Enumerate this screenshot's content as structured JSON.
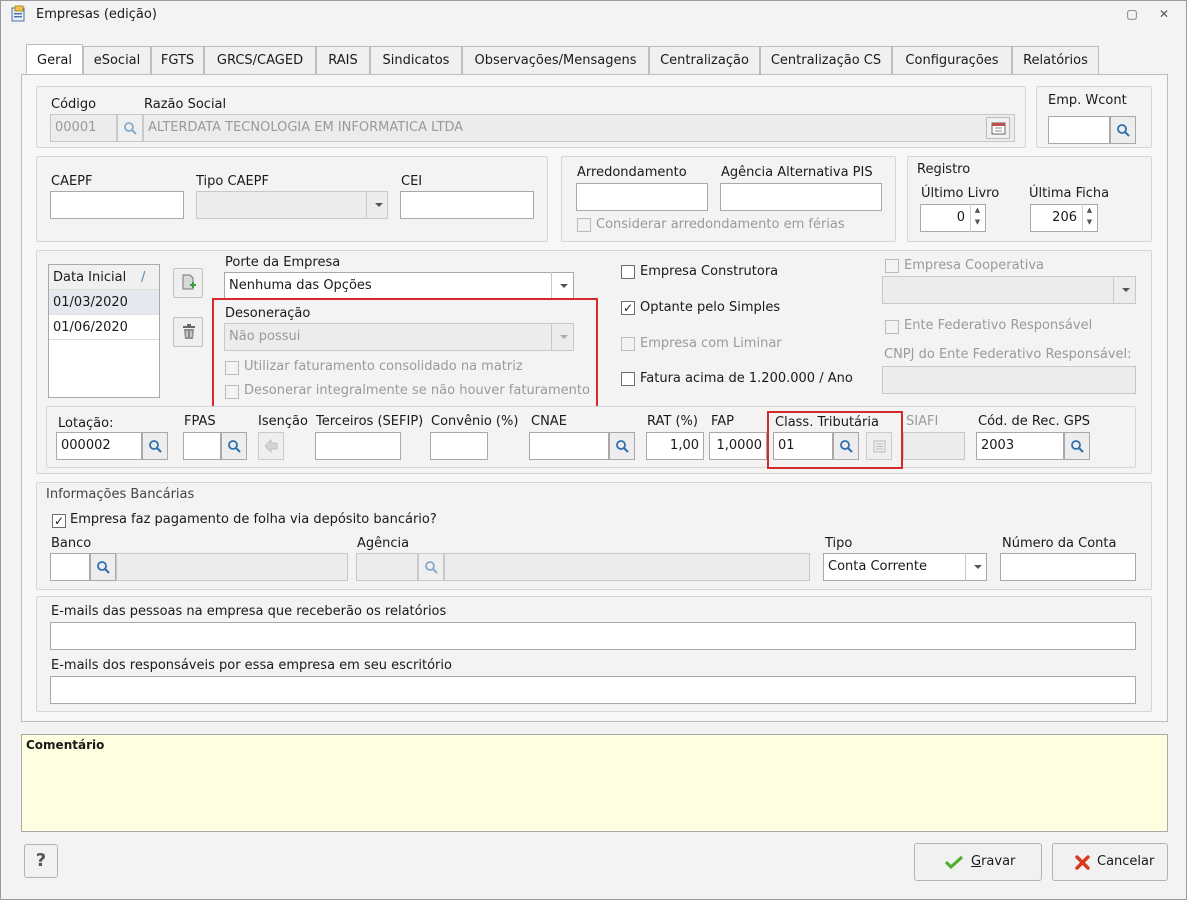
{
  "window": {
    "title": "Empresas (edição)",
    "restore_glyph": "▢",
    "close_glyph": "✕"
  },
  "tabs": [
    {
      "label": "Geral"
    },
    {
      "label": "eSocial"
    },
    {
      "label": "FGTS"
    },
    {
      "label": "GRCS/CAGED"
    },
    {
      "label": "RAIS"
    },
    {
      "label": "Sindicatos"
    },
    {
      "label": "Observações/Mensagens"
    },
    {
      "label": "Centralização"
    },
    {
      "label": "Centralização CS"
    },
    {
      "label": "Configurações"
    },
    {
      "label": "Relatórios"
    }
  ],
  "identity": {
    "codigo_label": "Código",
    "codigo_value": "00001",
    "razao_label": "Razão Social",
    "razao_value": "ALTERDATA TECNOLOGIA EM INFORMATICA LTDA",
    "emp_wcont_label": "Emp. Wcont",
    "emp_wcont_value": ""
  },
  "caepf": {
    "caepf_label": "CAEPF",
    "caepf_value": "",
    "tipo_label": "Tipo CAEPF",
    "tipo_value": "",
    "cei_label": "CEI",
    "cei_value": ""
  },
  "arred": {
    "arred_label": "Arredondamento",
    "arred_value": "",
    "agencia_pis_label": "Agência Alternativa PIS",
    "agencia_pis_value": "",
    "considerar_label": "Considerar arredondamento em férias"
  },
  "registro": {
    "title": "Registro",
    "livro_label": "Último Livro",
    "livro_value": "0",
    "ficha_label": "Última Ficha",
    "ficha_value": "206"
  },
  "periods": {
    "header": "Data Inicial",
    "sort_glyph": "/",
    "rows": [
      "01/03/2020",
      "01/06/2020"
    ]
  },
  "porte": {
    "label": "Porte da Empresa",
    "value": "Nenhuma das Opções"
  },
  "desoneracao": {
    "label": "Desoneração",
    "value": "Não possui",
    "utilizar_label": "Utilizar faturamento consolidado na matriz",
    "desonerar_label": "Desonerar integralmente se não houver faturamento"
  },
  "flags": {
    "construtora": "Empresa Construtora",
    "simples": "Optante pelo Simples",
    "liminar": "Empresa com Liminar",
    "fatura": "Fatura acima de 1.200.000 / Ano",
    "cooperativa": "Empresa Cooperativa",
    "ente": "Ente Federativo Responsável",
    "cnpj_ente_label": "CNPJ do Ente Federativo Responsável:",
    "cnpj_ente_value": "",
    "check_glyph": "✓"
  },
  "fiscal": {
    "lotacao_label": "Lotação:",
    "lotacao_value": "000002",
    "fpas_label": "FPAS",
    "fpas_value": "",
    "isencao_label": "Isenção",
    "terceiros_label": "Terceiros (SEFIP)",
    "terceiros_value": "",
    "convenio_label": "Convênio (%)",
    "convenio_value": "",
    "cnae_label": "CNAE",
    "cnae_value": "",
    "rat_label": "RAT (%)",
    "rat_value": "1,00",
    "fap_label": "FAP",
    "fap_value": "1,0000",
    "class_label": "Class. Tributária",
    "class_value": "01",
    "siafi_label": "SIAFI",
    "siafi_value": "",
    "gps_label": "Cód. de Rec. GPS",
    "gps_value": "2003"
  },
  "banco": {
    "title": "Informações Bancárias",
    "deposito_label": "Empresa faz pagamento de folha via depósito bancário?",
    "banco_label": "Banco",
    "banco_value": "",
    "agencia_label": "Agência",
    "agencia_value": "",
    "tipo_label": "Tipo",
    "tipo_value": "Conta Corrente",
    "numero_label": "Número da Conta",
    "numero_value": ""
  },
  "emails": {
    "empresa_label": "E-mails das pessoas na empresa que receberão os relatórios",
    "empresa_value": "",
    "escritorio_label": "E-mails dos responsáveis por essa empresa em seu escritório",
    "escritorio_value": ""
  },
  "comment": {
    "label": "Comentário"
  },
  "footer": {
    "help_glyph": "?",
    "gravar_first": "G",
    "gravar_rest": "ravar",
    "cancelar_label": "Cancelar"
  },
  "colors": {
    "highlight_border": "#d62a2a",
    "comment_bg": "#fefee0",
    "search_icon": "#2f6fb0"
  }
}
